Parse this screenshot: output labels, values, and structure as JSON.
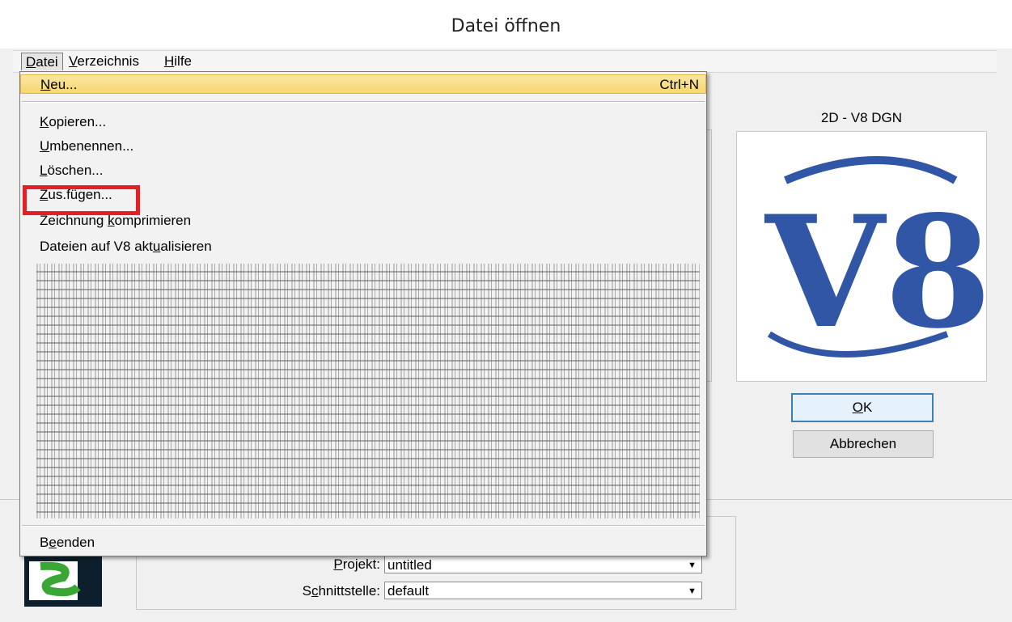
{
  "window": {
    "title": "Datei öffnen"
  },
  "menubar": {
    "items": [
      "Datei",
      "Verzeichnis",
      "Hilfe"
    ]
  },
  "file_menu": {
    "items": [
      {
        "label": "Neu...",
        "accel": "Ctrl+N"
      },
      {
        "label": "Kopieren..."
      },
      {
        "label": "Umbenennen..."
      },
      {
        "label": "Löschen..."
      },
      {
        "label": "Zus.fügen..."
      },
      {
        "label": "Zeichnung komprimieren"
      },
      {
        "label": "Dateien auf V8 aktualisieren"
      },
      {
        "label": "Beenden"
      }
    ]
  },
  "preview": {
    "label": "2D - V8 DGN",
    "logo_text": "V8",
    "logo_color": "#3156a6"
  },
  "buttons": {
    "ok": "OK",
    "cancel": "Abbrechen"
  },
  "workspace": {
    "project_label": "Projekt:",
    "project_value": "untitled",
    "interface_label": "Schnittstelle:",
    "interface_value": "default"
  },
  "colors": {
    "highlight": "#f6d66e",
    "annotation_red": "#e81e25"
  }
}
